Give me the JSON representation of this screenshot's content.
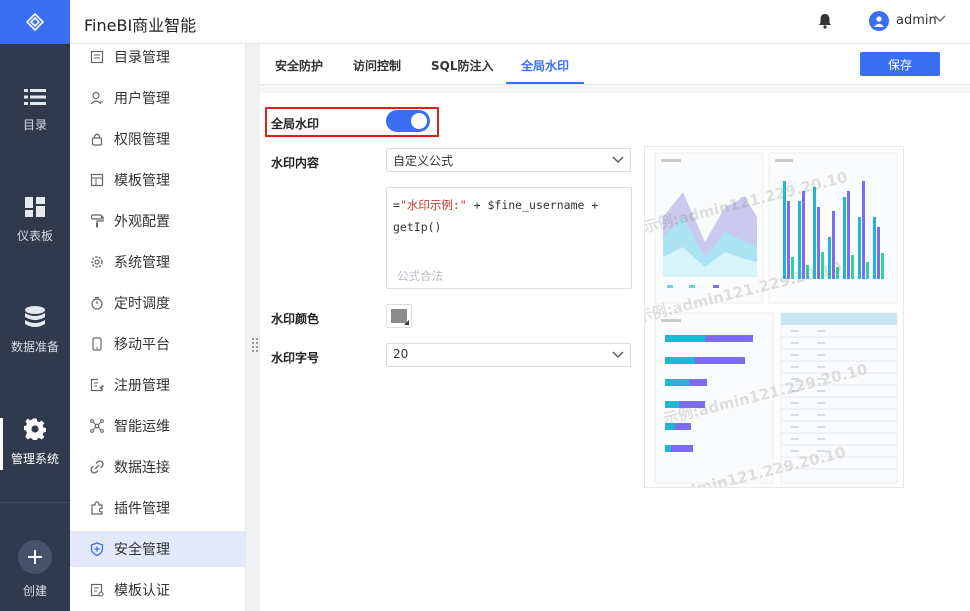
{
  "app": {
    "title": "FineBI商业智能"
  },
  "user": {
    "name": "admin"
  },
  "rail": [
    {
      "label": "目录",
      "icon": "list-icon"
    },
    {
      "label": "仪表板",
      "icon": "dashboard-icon"
    },
    {
      "label": "数据准备",
      "icon": "database-icon"
    },
    {
      "label": "管理系统",
      "icon": "gear-icon",
      "active": true
    },
    {
      "label": "创建",
      "icon": "plus-icon"
    }
  ],
  "subnav": [
    {
      "label": "目录管理"
    },
    {
      "label": "用户管理"
    },
    {
      "label": "权限管理"
    },
    {
      "label": "模板管理"
    },
    {
      "label": "外观配置"
    },
    {
      "label": "系统管理"
    },
    {
      "label": "定时调度"
    },
    {
      "label": "移动平台"
    },
    {
      "label": "注册管理"
    },
    {
      "label": "智能运维"
    },
    {
      "label": "数据连接"
    },
    {
      "label": "插件管理"
    },
    {
      "label": "安全管理",
      "active": true
    },
    {
      "label": "模板认证"
    }
  ],
  "tabs": [
    {
      "label": "安全防护"
    },
    {
      "label": "访问控制"
    },
    {
      "label": "SQL防注入"
    },
    {
      "label": "全局水印",
      "active": true
    }
  ],
  "save_label": "保存",
  "form": {
    "global_watermark_label": "全局水印",
    "global_watermark_enabled": true,
    "content_label": "水印内容",
    "content_value": "自定义公式",
    "formula_prefix": "=",
    "formula_string": "\"水印示例:\"",
    "formula_rest": " + $fine_username + getIp()",
    "formula_hint": "公式合法",
    "color_label": "水印颜色",
    "color_value": "#8c8c8c",
    "size_label": "水印字号",
    "size_value": "20"
  },
  "preview": {
    "watermark_text": "示例:admin121.229.20.10"
  },
  "colors": {
    "accent": "#3a6ff3",
    "rail": "#2f3a4d",
    "highlight": "#e02020"
  }
}
